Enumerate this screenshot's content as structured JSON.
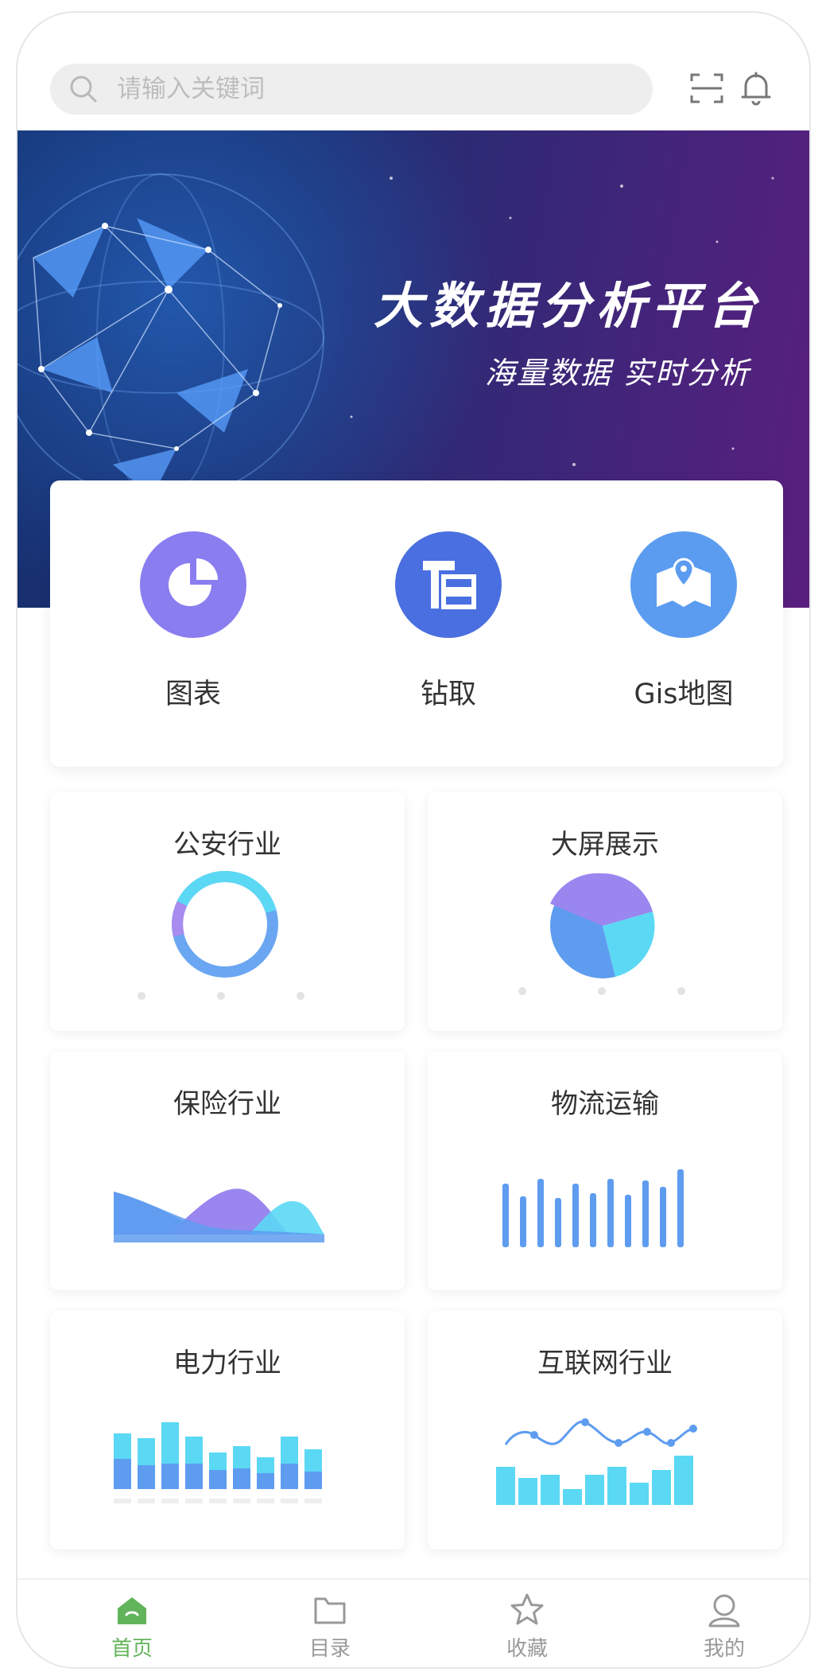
{
  "search": {
    "placeholder": "请输入关键词",
    "icon": "search-icon"
  },
  "header_icons": [
    "scan-icon",
    "bell-icon"
  ],
  "banner": {
    "title": "大数据分析平台",
    "subtitle": "海量数据  实时分析"
  },
  "quick_links": [
    {
      "label": "图表",
      "icon": "pie-chart-icon",
      "color": "#8a7df0"
    },
    {
      "label": "钻取",
      "icon": "drill-icon",
      "color": "#4a6fe0"
    },
    {
      "label": "Gis地图",
      "icon": "map-icon",
      "color": "#5b9cf0"
    }
  ],
  "cards": [
    {
      "title": "公安行业",
      "icon": "donut-chart-icon"
    },
    {
      "title": "大屏展示",
      "icon": "pie-chart-icon"
    },
    {
      "title": "保险行业",
      "icon": "area-chart-icon"
    },
    {
      "title": "物流运输",
      "icon": "bar-chart-icon"
    },
    {
      "title": "电力行业",
      "icon": "stacked-bar-chart-icon"
    },
    {
      "title": "互联网行业",
      "icon": "bar-line-chart-icon"
    }
  ],
  "tabbar": [
    {
      "label": "首页",
      "icon": "home-icon",
      "active": true
    },
    {
      "label": "目录",
      "icon": "folder-icon",
      "active": false
    },
    {
      "label": "收藏",
      "icon": "star-icon",
      "active": false
    },
    {
      "label": "我的",
      "icon": "user-icon",
      "active": false
    }
  ],
  "colors": {
    "accent": "#62b45a",
    "chart_blue": "#5e9cf0",
    "chart_cyan": "#5bd8f4",
    "chart_purple": "#9a86ef"
  }
}
